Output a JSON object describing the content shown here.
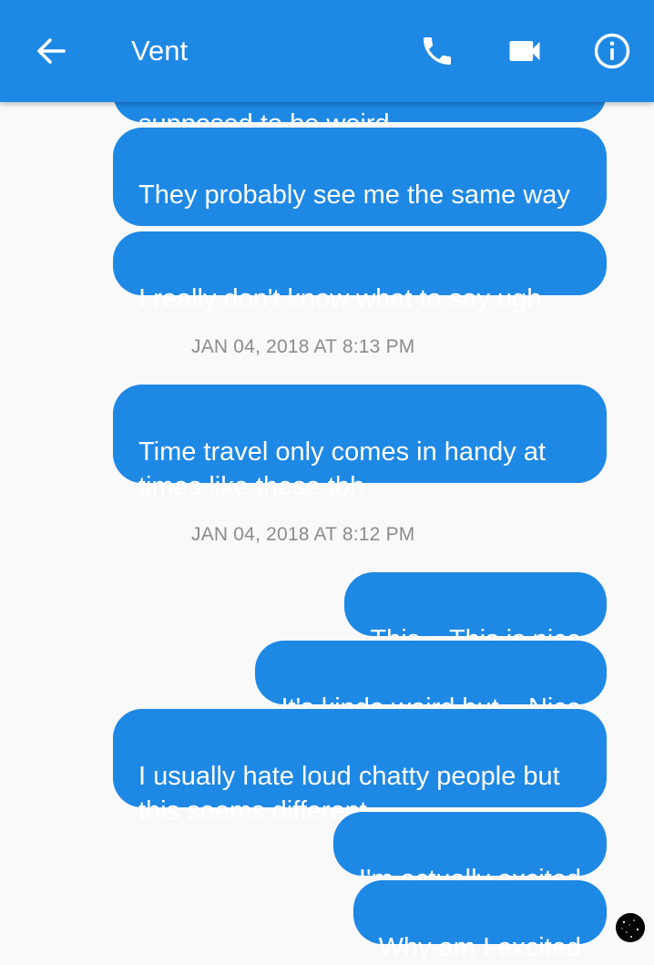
{
  "header": {
    "title": "Vent",
    "back_icon": "arrow-left-icon",
    "call_icon": "phone-icon",
    "video_icon": "video-camera-icon",
    "info_icon": "info-icon",
    "background_color": "#1e88e5"
  },
  "messages": {
    "partial_top": "supposed to be weird",
    "m1": "They probably see me the same way",
    "m2": "I really don't know what to say ugh",
    "ts1": "JAN 04, 2018 AT 8:13 PM",
    "m3": "Time travel only comes in handy at times like these tbh",
    "ts2": "JAN 04, 2018 AT 8:12 PM",
    "m4": "This... This is nice",
    "m5": "It's kinda weird but... Nice",
    "m6": "I usually hate loud chatty people but this seems different",
    "m7": "I'm actually excited",
    "m8": "Why am I excited"
  },
  "bubble_color": "#1e88e5",
  "timestamp_color": "#8c8c8c"
}
